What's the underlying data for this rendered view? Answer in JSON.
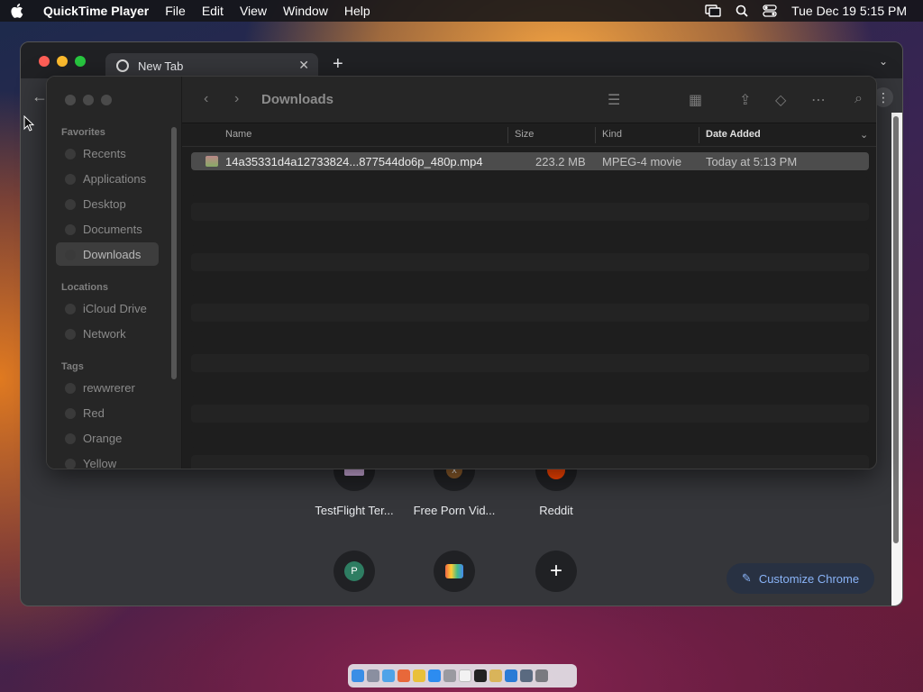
{
  "menubar": {
    "app_name": "QuickTime Player",
    "menus": [
      "File",
      "Edit",
      "View",
      "Window",
      "Help"
    ],
    "clock": "Tue Dec 19  5:15 PM"
  },
  "chrome": {
    "tab_title": "New Tab",
    "shortcuts": [
      {
        "label": "TestFlight Ter...",
        "icon": "testflight-icon"
      },
      {
        "label": "Free Porn Vid...",
        "icon": "x-site-icon"
      },
      {
        "label": "Reddit",
        "icon": "reddit-icon"
      },
      {
        "label": "",
        "icon": "p-avatar-icon",
        "letter": "P"
      },
      {
        "label": "",
        "icon": "store-icon"
      },
      {
        "label": "",
        "icon": "add-shortcut-icon"
      }
    ],
    "customize_label": "Customize Chrome"
  },
  "finder": {
    "title": "Downloads",
    "sidebar": {
      "favorites_header": "Favorites",
      "favorites": [
        "Recents",
        "Applications",
        "Desktop",
        "Documents",
        "Downloads"
      ],
      "selected": "Downloads",
      "locations_header": "Locations",
      "locations": [
        "iCloud Drive",
        "Network"
      ],
      "tags_header": "Tags",
      "tags": [
        "rewwrerer",
        "Red",
        "Orange",
        "Yellow"
      ]
    },
    "columns": {
      "name": "Name",
      "size": "Size",
      "kind": "Kind",
      "date_added": "Date Added"
    },
    "files": [
      {
        "name": "14a35331d4a12733824...877544do6p_480p.mp4",
        "size": "223.2 MB",
        "kind": "MPEG-4 movie",
        "date_added": "Today at 5:13 PM"
      }
    ]
  },
  "colors": {
    "chrome_bg": "#35363a",
    "finder_bg": "#1e1e1e",
    "accent_blue": "#8ab4f8"
  }
}
